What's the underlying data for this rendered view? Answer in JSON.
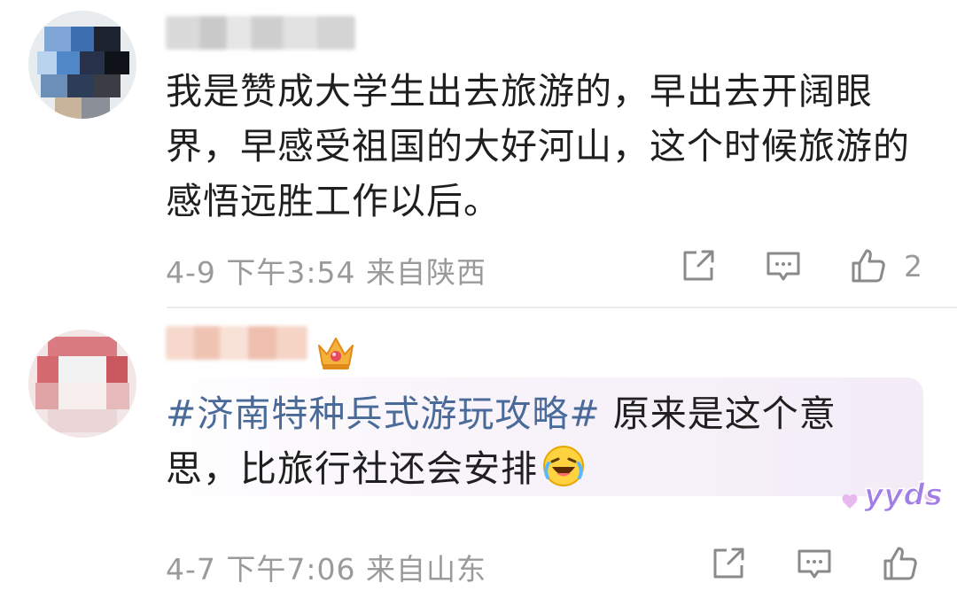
{
  "comments": [
    {
      "text": "我是赞成大学生出去旅游的，早出去开阔眼界，早感受祖国的大好河山，这个时候旅游的感悟远胜工作以后。",
      "date": "4-9",
      "time": "下午3:54",
      "location": "来自陕西",
      "like_count": "2",
      "icons": {
        "share": "share-icon",
        "comment": "comment-icon",
        "like": "thumbs-up-icon"
      }
    },
    {
      "hashtag": "#济南特种兵式游玩攻略#",
      "text": " 原来是这个意思，比旅行社还会安排",
      "emoji": "laughing-crying-emoji",
      "badge": "crown-icon",
      "sticker_text": "yyds",
      "date": "4-7",
      "time": "下午7:06",
      "location": "来自山东",
      "icons": {
        "share": "share-icon",
        "comment": "comment-icon",
        "like": "thumbs-up-icon"
      }
    }
  ],
  "colors": {
    "hashtag": "#4a6a99",
    "meta": "#9a9a9a",
    "text": "#1f1f1f",
    "sticker": "#a07ee6"
  }
}
